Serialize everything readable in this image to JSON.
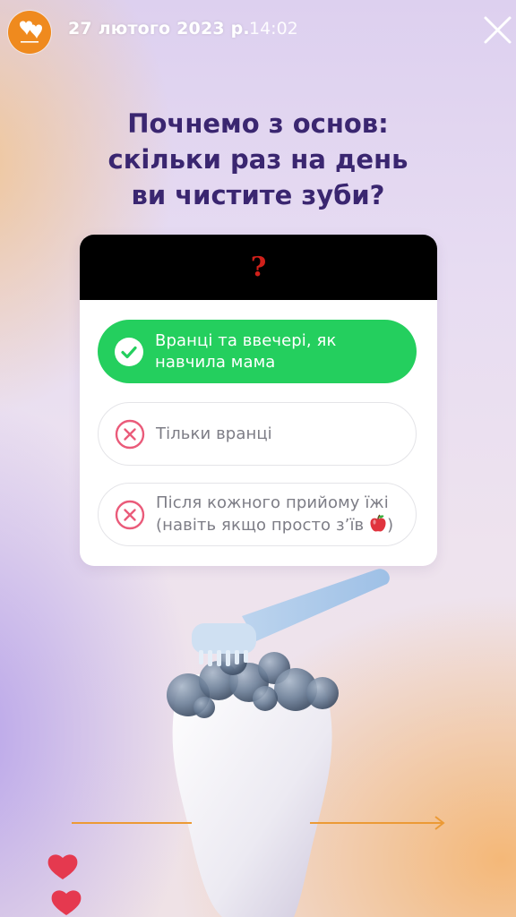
{
  "header": {
    "date": "27 лютого 2023 р.",
    "time": "14:02",
    "avatar_icon": "clinic-logo-icon",
    "close_icon": "close-icon"
  },
  "quiz": {
    "question_lines": [
      "Почнемо з основ:",
      "скільки раз на день",
      "ви чистите зуби?"
    ],
    "header_symbol": "?",
    "options": [
      {
        "lines": [
          "Вранці та ввечері, як",
          "навчила мама"
        ],
        "state": "correct",
        "icon": "check-icon"
      },
      {
        "lines": [
          "Тільки вранці"
        ],
        "state": "wrong",
        "icon": "cross-icon"
      },
      {
        "lines": [
          "Після кожного прийому їжі",
          "(навіть якщо просто з’їв"
        ],
        "emoji": "apple-icon",
        "closing": ")",
        "state": "wrong",
        "icon": "cross-icon"
      }
    ]
  },
  "colors": {
    "accent_green": "#24cf5e",
    "question_text": "#3a2670",
    "wrong_icon": "#ea5b7a",
    "avatar_bg": "#ef8a1e",
    "arrow": "#ec9a35",
    "heart": "#e5394f"
  }
}
